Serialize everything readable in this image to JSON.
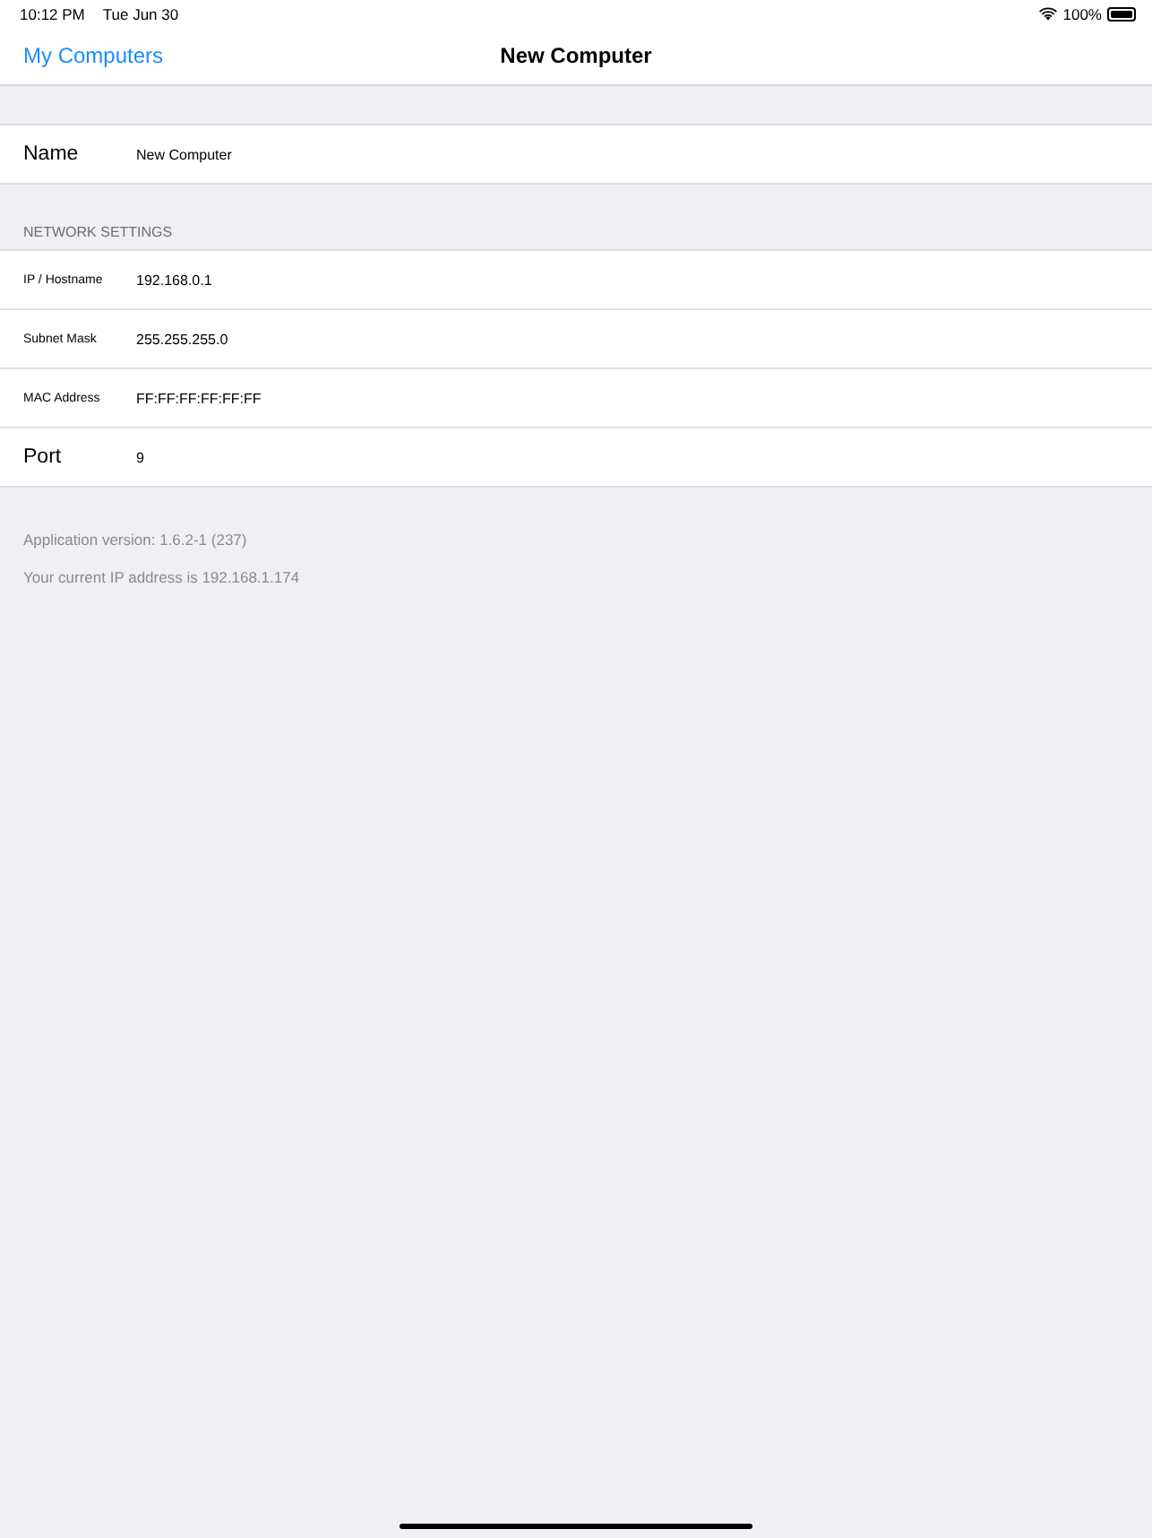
{
  "status_bar": {
    "time": "10:12 PM",
    "date": "Tue Jun 30",
    "battery": "100%"
  },
  "nav_bar": {
    "back": "My Computers",
    "title": "New Computer"
  },
  "sections": [
    {
      "rows": [
        {
          "kind": "large",
          "label": "Name",
          "value": "New Computer"
        }
      ]
    },
    {
      "header": "NETWORK SETTINGS",
      "rows": [
        {
          "kind": "small",
          "label": "IP / Hostname",
          "value": "192.168.0.1"
        },
        {
          "kind": "small",
          "label": "Subnet Mask",
          "value": "255.255.255.0"
        },
        {
          "kind": "small",
          "label": "MAC Address",
          "value": "FF:FF:FF:FF:FF:FF"
        },
        {
          "kind": "large",
          "label": "Port",
          "value": "9"
        }
      ]
    }
  ],
  "footer": [
    "Application version: 1.6.2-1 (237)",
    "Your current IP address is 192.168.1.174"
  ]
}
